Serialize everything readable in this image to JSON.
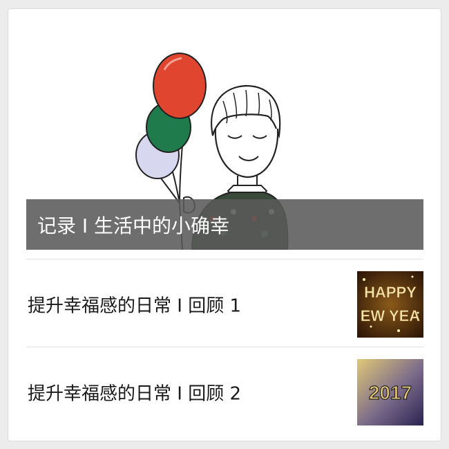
{
  "cover": {
    "title": "记录 I 生活中的小确幸",
    "image": "illustration-boy-with-balloons"
  },
  "articles": [
    {
      "title": "提升幸福感的日常 I 回顾 1",
      "thumb_text": [
        "HAPPY",
        "EW YEA"
      ],
      "thumb_icon": "happy-new-year-thumbnail"
    },
    {
      "title": "提升幸福感的日常 I 回顾 2",
      "thumb_text": [
        "2017"
      ],
      "thumb_icon": "year-2017-thumbnail"
    }
  ],
  "colors": {
    "caption_bg": "#5a5a5a",
    "balloon_red": "#e0452f",
    "balloon_green": "#1f7a4c",
    "balloon_lavender": "#d7d7f0",
    "sweater": "#3a4a3a"
  }
}
